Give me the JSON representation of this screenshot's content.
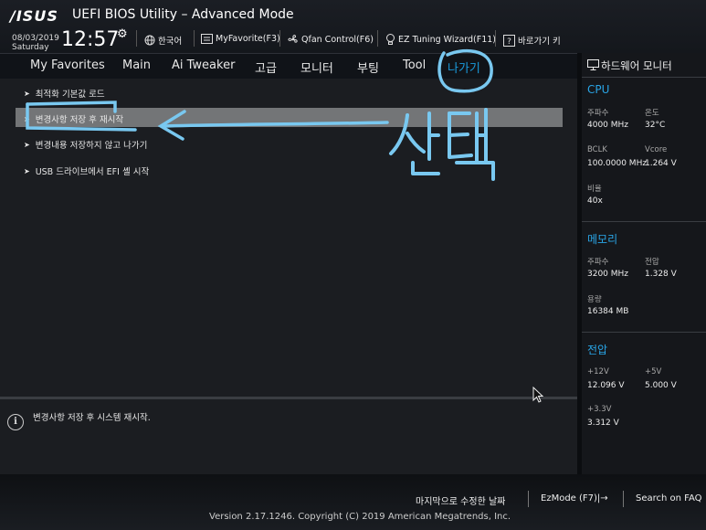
{
  "header": {
    "logo": "/ISUS",
    "title": "UEFI BIOS Utility – Advanced Mode",
    "date": "08/03/2019",
    "day": "Saturday",
    "time": "12:57",
    "tools": [
      {
        "icon": "globe-icon",
        "label": "한국어"
      },
      {
        "icon": "favorite-icon",
        "label": "MyFavorite(F3)"
      },
      {
        "icon": "fan-icon",
        "label": "Qfan Control(F6)"
      },
      {
        "icon": "bulb-icon",
        "label": "EZ Tuning Wizard(F11)"
      },
      {
        "icon": "help-icon",
        "label": "바로가기 키"
      }
    ]
  },
  "nav": {
    "tabs": [
      "My Favorites",
      "Main",
      "Ai Tweaker",
      "고급",
      "모니터",
      "부팅",
      "Tool",
      "나가기"
    ],
    "active": "나가기"
  },
  "menu": {
    "items": [
      "최적화 기본값 로드",
      "변경사항 저장 후 재시작",
      "변경내용 저장하지 않고 나가기",
      "USB 드라이브에서 EFI 셸 시작"
    ],
    "selected_index": 1
  },
  "help": {
    "text": "변경사항 저장 후 시스템 재시작."
  },
  "monitor": {
    "title": "하드웨어 모니터",
    "cpu": {
      "heading": "CPU",
      "freq_label": "주파수",
      "freq": "4000 MHz",
      "temp_label": "온도",
      "temp": "32°C",
      "bclk_label": "BCLK",
      "bclk": "100.0000 MHz",
      "vcore_label": "Vcore",
      "vcore": "1.264 V",
      "ratio_label": "비율",
      "ratio": "40x"
    },
    "memory": {
      "heading": "메모리",
      "freq_label": "주파수",
      "freq": "3200 MHz",
      "volt_label": "전압",
      "volt": "1.328 V",
      "cap_label": "용량",
      "cap": "16384 MB"
    },
    "voltage": {
      "heading": "전압",
      "v12_label": "+12V",
      "v12": "12.096 V",
      "v5_label": "+5V",
      "v5": "5.000 V",
      "v33_label": "+3.3V",
      "v33": "3.312 V"
    }
  },
  "footer": {
    "last_modified": "마지막으로 수정한 날짜",
    "ezmode": "EzMode (F7)|→",
    "faq": "Search on FAQ",
    "version": "Version 2.17.1246. Copyright (C) 2019 American Megatrends, Inc."
  },
  "annotation": {
    "text": "선택",
    "color": "#79c8f0"
  },
  "colors": {
    "accent": "#1a9bdc",
    "selected_row": "#737577"
  }
}
